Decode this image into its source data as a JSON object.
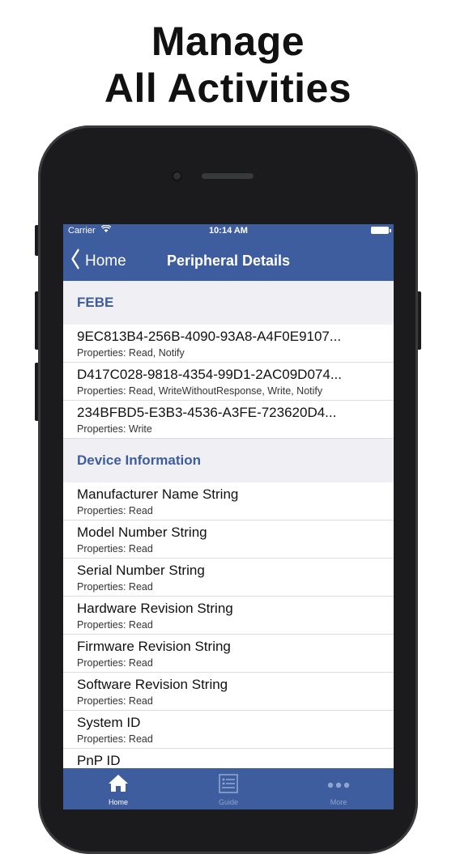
{
  "headline": {
    "line1": "Manage",
    "line2": "All Activities"
  },
  "status_bar": {
    "carrier": "Carrier",
    "time": "10:14 AM"
  },
  "navbar": {
    "back_label": "Home",
    "title": "Peripheral Details"
  },
  "sections": [
    {
      "title": "FEBE",
      "rows": [
        {
          "name": "9EC813B4-256B-4090-93A8-A4F0E9107...",
          "props": "Properties: Read, Notify"
        },
        {
          "name": "D417C028-9818-4354-99D1-2AC09D074...",
          "props": "Properties: Read, WriteWithoutResponse, Write, Notify"
        },
        {
          "name": "234BFBD5-E3B3-4536-A3FE-723620D4...",
          "props": "Properties: Write"
        }
      ]
    },
    {
      "title": "Device Information",
      "rows": [
        {
          "name": "Manufacturer Name String",
          "props": "Properties: Read"
        },
        {
          "name": "Model Number String",
          "props": "Properties: Read"
        },
        {
          "name": "Serial Number String",
          "props": "Properties: Read"
        },
        {
          "name": "Hardware Revision String",
          "props": "Properties: Read"
        },
        {
          "name": "Firmware Revision String",
          "props": "Properties: Read"
        },
        {
          "name": "Software Revision String",
          "props": "Properties: Read"
        },
        {
          "name": "System ID",
          "props": "Properties: Read"
        },
        {
          "name": "PnP ID",
          "props": ""
        }
      ]
    }
  ],
  "tabbar": {
    "tabs": [
      {
        "label": "Home",
        "icon": "home-icon",
        "active": true
      },
      {
        "label": "Guide",
        "icon": "guide-icon",
        "active": false
      },
      {
        "label": "More",
        "icon": "more-icon",
        "active": false
      }
    ]
  },
  "colors": {
    "brand": "#3e5d9e",
    "section_text": "#3e5d9e",
    "background": "#efeff4"
  }
}
